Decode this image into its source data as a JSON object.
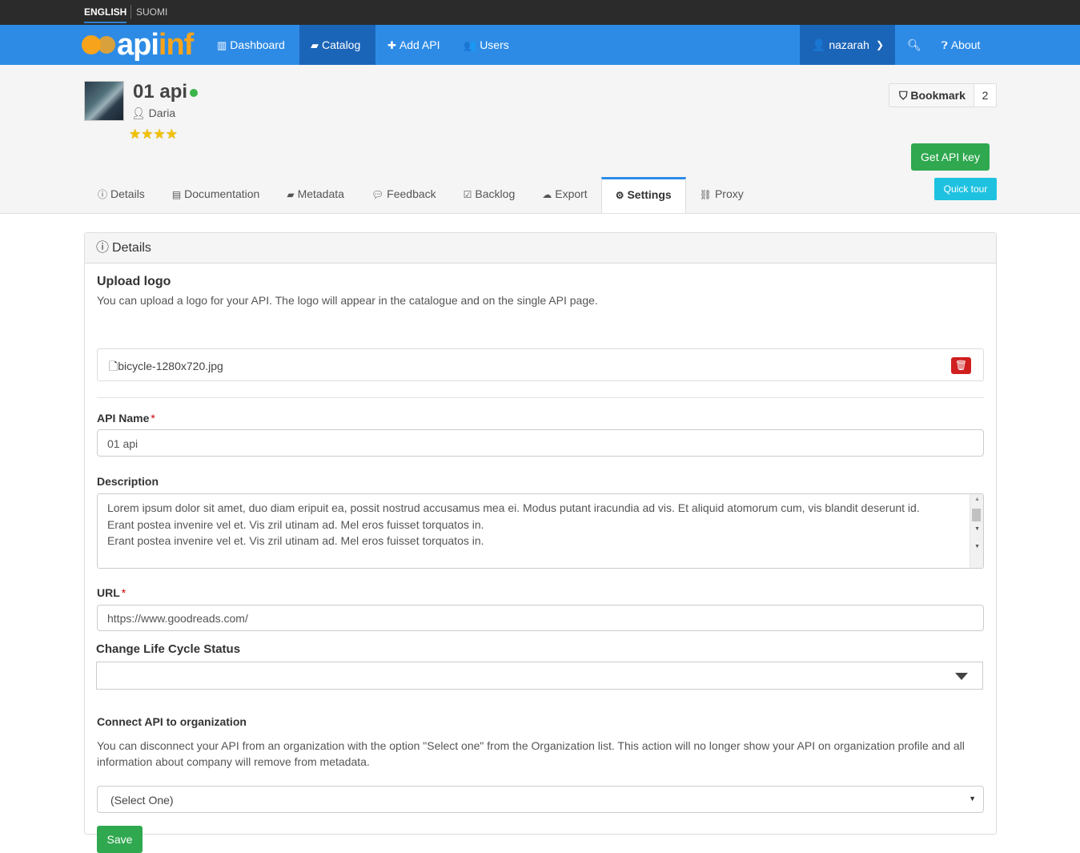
{
  "lang": {
    "english": "ENGLISH",
    "suomi": "SUOMI"
  },
  "brand": {
    "api": "api",
    "inf": "inf"
  },
  "nav": {
    "dashboard": "Dashboard",
    "catalog": "Catalog",
    "add_api": "Add API",
    "users": "Users",
    "user": "nazarah",
    "about": "About"
  },
  "api": {
    "title": "01 api",
    "owner": "Daria",
    "rating": 4,
    "stars": "★★★★",
    "bookmark_label": "Bookmark",
    "bookmark_count": "2",
    "get_key": "Get API key",
    "quick_tour": "Quick tour"
  },
  "tabs": [
    {
      "label": "Details",
      "icon": "info-circle-icon"
    },
    {
      "label": "Documentation",
      "icon": "file-icon"
    },
    {
      "label": "Metadata",
      "icon": "book-icon"
    },
    {
      "label": "Feedback",
      "icon": "comments-icon"
    },
    {
      "label": "Backlog",
      "icon": "check-square-icon"
    },
    {
      "label": "Export",
      "icon": "cloud-download-icon"
    },
    {
      "label": "Settings",
      "icon": "gear-icon"
    },
    {
      "label": "Proxy",
      "icon": "sitemap-icon"
    }
  ],
  "panel": {
    "heading": "Details",
    "upload_title": "Upload logo",
    "upload_help": "You can upload a logo for your API. The logo will appear in the catalogue and on the single API page.",
    "file_name": "bicycle-1280x720.jpg",
    "api_name_label": "API Name",
    "api_name_value": "01 api",
    "description_label": "Description",
    "description_lines": [
      "Lorem ipsum dolor sit amet, duo diam eripuit ea, possit nostrud accusamus mea ei. Modus putant iracundia ad vis. Et aliquid atomorum cum, vis blandit deserunt id.",
      "Erant postea invenire vel et. Vis zril utinam ad. Mel eros fuisset torquatos in.",
      "Erant postea invenire vel et. Vis zril utinam ad. Mel eros fuisset torquatos in."
    ],
    "url_label": "URL",
    "url_value": "https://www.goodreads.com/",
    "lifecycle_label": "Change Life Cycle Status",
    "org_label": "Connect API to organization",
    "org_help": "You can disconnect your API from an organization with the option \"Select one\" from the Organization list. This action will no longer show your API on organization profile and all information about company will remove from metadata.",
    "org_select": "(Select One)",
    "save": "Save",
    "required_mark": "*"
  },
  "colors": {
    "navbar": "#2d8be6",
    "nav_active": "#1b65b8",
    "success": "#2fa84f",
    "info": "#1ec2e0",
    "danger": "#d01f1f",
    "brand_orange": "#f7a41c"
  }
}
